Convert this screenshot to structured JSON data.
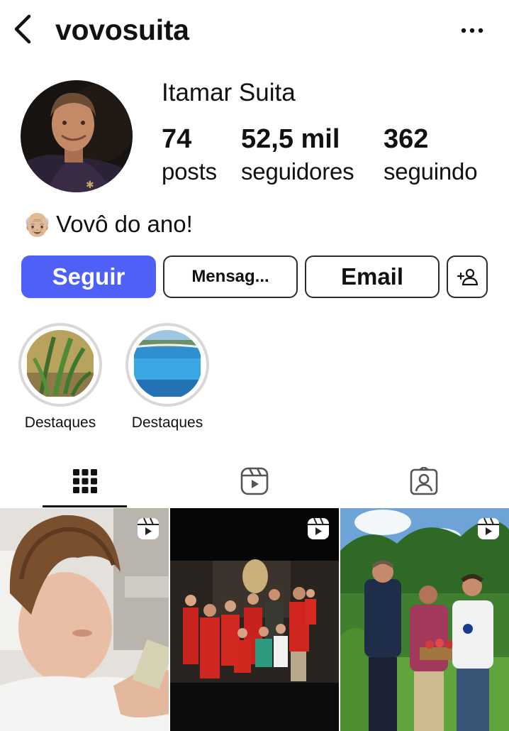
{
  "header": {
    "username": "vovosuita",
    "back_icon": "chevron-left-icon",
    "more_icon": "more-horizontal-icon"
  },
  "profile": {
    "display_name": "Itamar Suita",
    "stats": {
      "posts": {
        "value": "74",
        "label": "posts"
      },
      "followers": {
        "value": "52,5 mil",
        "label": "seguidores"
      },
      "following": {
        "value": "362",
        "label": "seguindo"
      }
    },
    "bio": {
      "emoji": "👴🏼",
      "text": "Vovô do ano!"
    }
  },
  "actions": {
    "follow_label": "Seguir",
    "message_label": "Mensag...",
    "email_label": "Email",
    "add_user_icon": "add-user-icon"
  },
  "highlights": [
    {
      "label": "Destaques"
    },
    {
      "label": "Destaques"
    }
  ],
  "tabs": [
    {
      "icon": "grid-icon",
      "active": true
    },
    {
      "icon": "reels-icon",
      "active": false
    },
    {
      "icon": "tagged-icon",
      "active": false
    }
  ],
  "posts": [
    {
      "type": "reel",
      "icon": "reels-icon"
    },
    {
      "type": "reel",
      "icon": "reels-icon"
    },
    {
      "type": "reel",
      "icon": "reels-icon"
    }
  ],
  "colors": {
    "accent": "#4f60f6",
    "text": "#111111",
    "ring": "#d8d8d8"
  }
}
